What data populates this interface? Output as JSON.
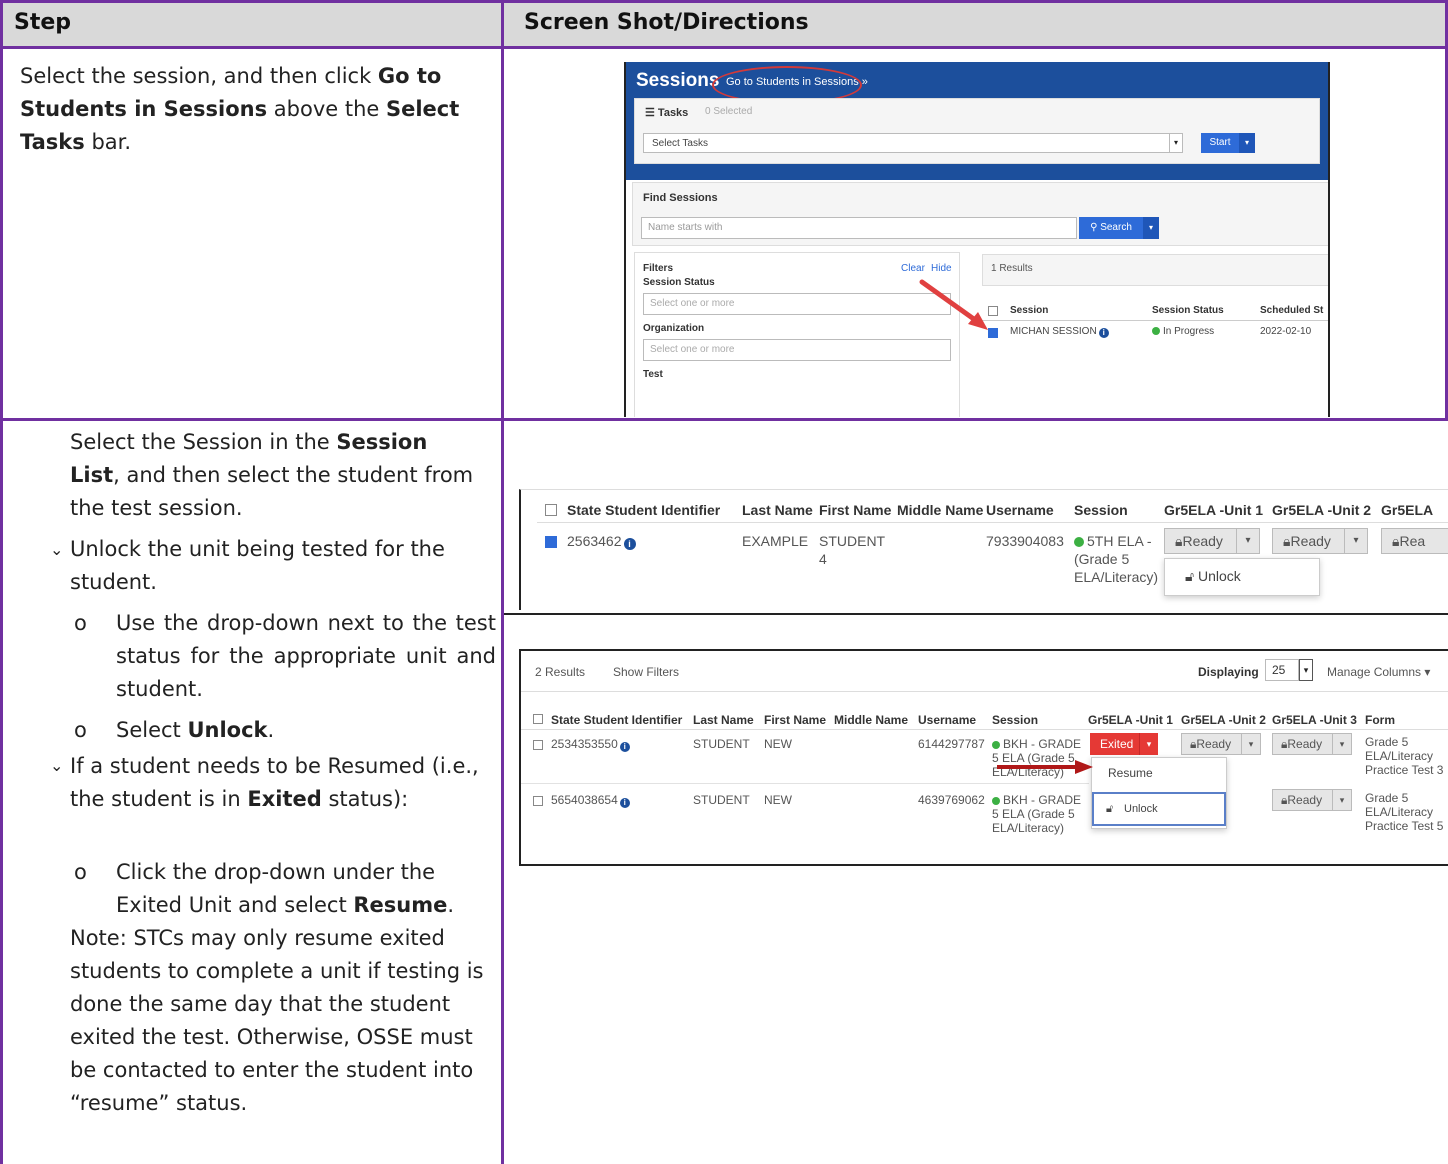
{
  "table": {
    "header_step": "Step",
    "header_directions": "Screen Shot/Directions"
  },
  "row1": {
    "text_1": "Select the session, and then click ",
    "bold_1": "Go to Students in Sessions",
    "text_2": " above the ",
    "bold_2": "Select Tasks",
    "text_3": " bar."
  },
  "row2": {
    "intro_1": "Select the Session in the ",
    "intro_bold": "Session List",
    "intro_2": ", and then select the student from the test session.",
    "bullet_1": "Unlock the unit being tested for the student.",
    "sub_1": "Use the drop-down next to the test status for the appropriate unit and student.",
    "sub_2_prefix": "Select ",
    "sub_2_bold": "Unlock",
    "sub_2_suffix": ".",
    "bullet_2_a": "If a student needs to be Resumed (i.e., the student is in ",
    "bullet_2_bold": "Exited",
    "bullet_2_b": " status):",
    "sub_3_prefix": "Click the drop-down under the Exited Unit and select ",
    "sub_3_bold": "Resume",
    "sub_3_suffix": ".",
    "note": "Note: STCs may only resume exited students to complete a unit if testing is done the same day that the student exited the test. Otherwise, OSSE must be contacted to enter the student into “resume” status.",
    "bullet_glyph": "⌄",
    "sub_glyph": "o"
  },
  "shot1": {
    "title": "Sessions",
    "goto_link": "Go to Students in Sessions »",
    "tasks_label": "Tasks",
    "tasks_selected": "0 Selected",
    "select_tasks": "Select Tasks",
    "start": "Start",
    "find_sessions": "Find Sessions",
    "name_placeholder": "Name starts with",
    "search": "Search",
    "filters": "Filters",
    "clear": "Clear",
    "hide": "Hide",
    "session_status": "Session Status",
    "select_one": "Select one or more",
    "organization": "Organization",
    "test": "Test",
    "results": "1 Results",
    "col_session": "Session",
    "col_status": "Session Status",
    "col_scheduled": "Scheduled St",
    "row_session": "MICHAN SESSION",
    "row_status": "In Progress",
    "row_date": "2022-02-10",
    "accent": "#1c4f9c"
  },
  "shot2": {
    "headers": [
      "State Student Identifier",
      "Last Name",
      "First Name",
      "Middle Name",
      "Username",
      "Session",
      "Gr5ELA -Unit 1",
      "Gr5ELA -Unit 2",
      "Gr5ELA"
    ],
    "ssid": "2563462",
    "last": "EXAMPLE",
    "first_1": "STUDENT",
    "first_2": "4",
    "username": "7933904083",
    "session_1": "5TH ELA -",
    "session_2": "(Grade 5",
    "session_3": "ELA/Literacy)",
    "ready": "Ready",
    "ready_cut": "Rea",
    "unlock": "Unlock"
  },
  "shot3": {
    "results": "2 Results",
    "show_filters": "Show Filters",
    "displaying": "Displaying",
    "per_page": "25",
    "manage_columns": "Manage Columns",
    "headers": [
      "State Student Identifier",
      "Last Name",
      "First Name",
      "Middle Name",
      "Username",
      "Session",
      "Gr5ELA -Unit 1",
      "Gr5ELA -Unit 2",
      "Gr5ELA -Unit 3",
      "Form"
    ],
    "rows": [
      {
        "ssid": "2534353550",
        "last": "STUDENT",
        "first": "NEW",
        "username": "6144297787",
        "s1": "BKH - GRADE",
        "s2": "5 ELA (Grade 5",
        "s3": "ELA/Literacy)",
        "f1": "Grade 5",
        "f2": "ELA/Literacy",
        "f3": "Practice Test 3"
      },
      {
        "ssid": "5654038654",
        "last": "STUDENT",
        "first": "NEW",
        "username": "4639769062",
        "s1": "BKH - GRADE",
        "s2": "5 ELA (Grade 5",
        "s3": "ELA/Literacy)",
        "f1": "Grade 5",
        "f2": "ELA/Literacy",
        "f3": "Practice Test 5"
      }
    ],
    "exited": "Exited",
    "ready": "Ready",
    "ready_cut": "dy",
    "resume": "Resume",
    "unlock": "Unlock",
    "exited_color": "#e53935"
  }
}
